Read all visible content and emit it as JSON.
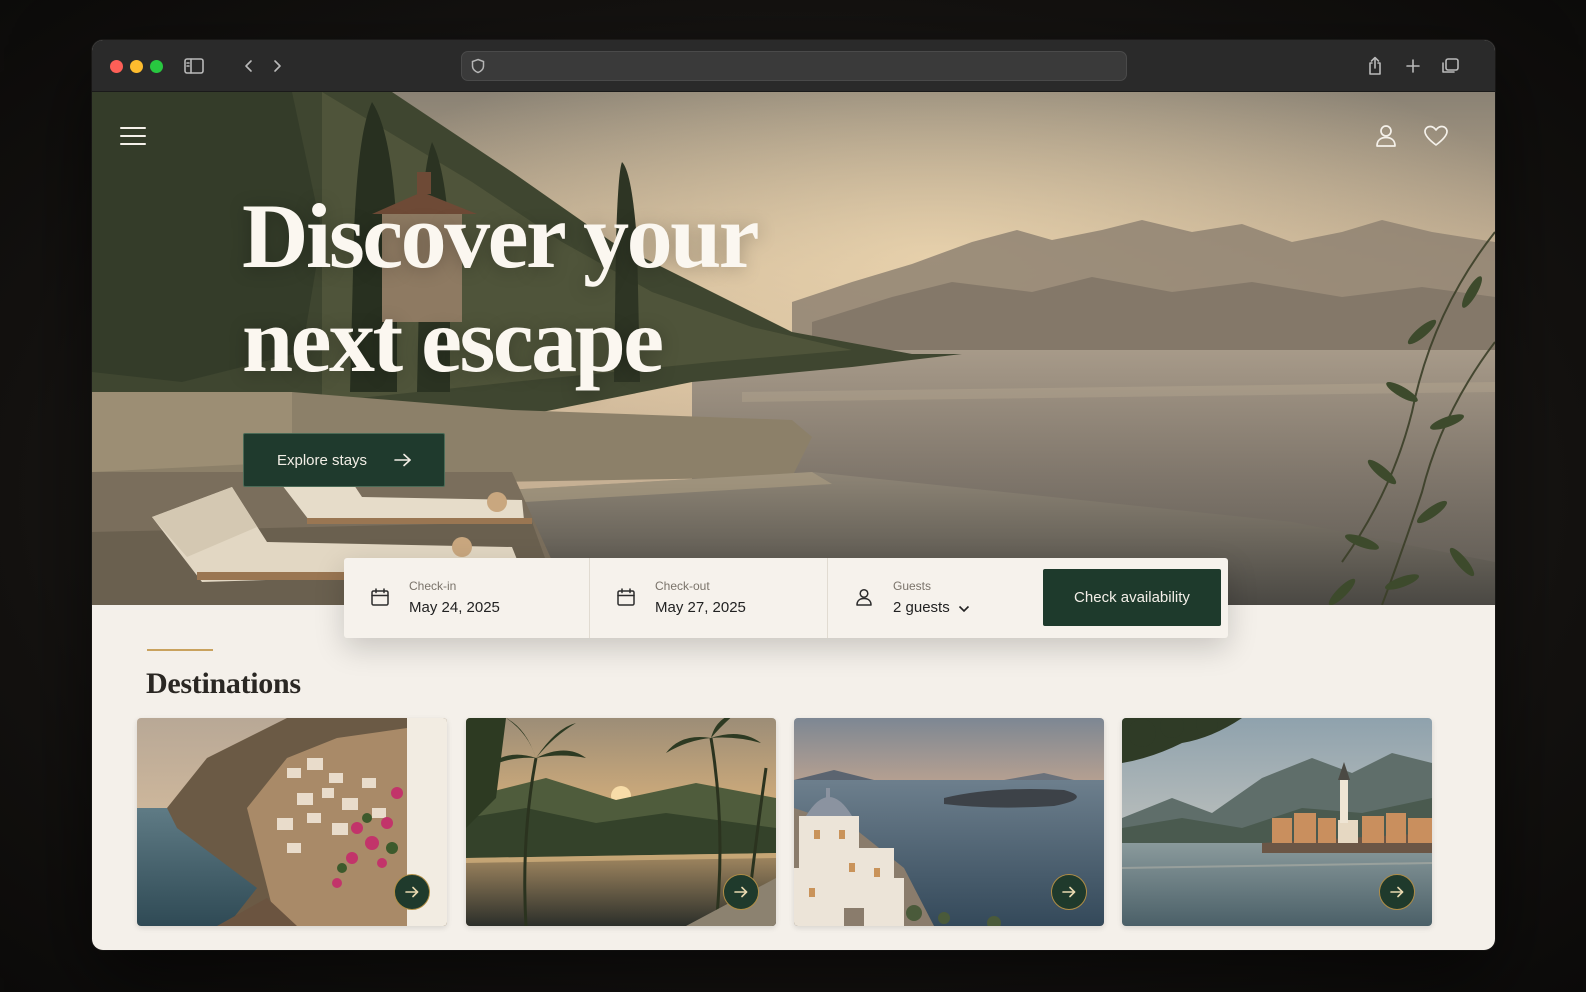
{
  "browser": {
    "url": "",
    "icons": [
      "sidebar-icon",
      "back-icon",
      "forward-icon",
      "shield-icon",
      "share-icon",
      "new-tab-icon",
      "tabs-overview-icon"
    ]
  },
  "hero": {
    "title_line1": "Discover your",
    "title_line2": "next escape",
    "cta_label": "Explore stays",
    "icons": [
      "menu-icon",
      "account-icon",
      "favorites-icon"
    ]
  },
  "booking": {
    "checkin": {
      "label": "Check-in",
      "value": "May 24, 2025"
    },
    "checkout": {
      "label": "Check-out",
      "value": "May 27, 2025"
    },
    "guests": {
      "label": "Guests",
      "value": "2 guests"
    },
    "submit_label": "Check availability"
  },
  "destinations": {
    "title": "Destinations",
    "accent_color": "#c9a25e",
    "cards": [
      {
        "scene": "coastal-cliff-village"
      },
      {
        "scene": "tropical-infinity-pool"
      },
      {
        "scene": "white-domed-island-town"
      },
      {
        "scene": "alpine-lake-village"
      }
    ]
  },
  "colors": {
    "brand_green": "#1e3a2c",
    "background": "#f4f0ea"
  }
}
